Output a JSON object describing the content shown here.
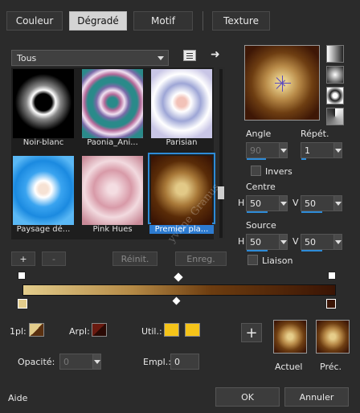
{
  "tabs": [
    {
      "label": "Couleur"
    },
    {
      "label": "Dégradé",
      "active": true
    },
    {
      "label": "Motif"
    },
    {
      "label": "Texture"
    }
  ],
  "category": {
    "value": "Tous"
  },
  "gallery": [
    {
      "name": "Noir-blanc"
    },
    {
      "name": "Paonia_Ani..."
    },
    {
      "name": "Parisian"
    },
    {
      "name": "Paysage dé..."
    },
    {
      "name": "Pink Hues"
    },
    {
      "name": "Premier pla...",
      "selected": true
    }
  ],
  "gallery_buttons": {
    "add": "+",
    "remove": "-",
    "reset": "Réinit.",
    "save": "Enreg."
  },
  "angle": {
    "label": "Angle",
    "value": "90"
  },
  "repeat": {
    "label": "Répét.",
    "value": "1"
  },
  "invert": {
    "label": "Invers"
  },
  "center": {
    "label": "Centre",
    "h_label": "H",
    "h_value": "50",
    "v_label": "V",
    "v_value": "50"
  },
  "source": {
    "label": "Source",
    "h_label": "H",
    "h_value": "50",
    "v_label": "V",
    "v_value": "50"
  },
  "link": {
    "label": "Liaison"
  },
  "watermark": "yvline Granus",
  "bottom": {
    "fg_label": "1pl:",
    "bg_label": "Arpl:",
    "user_label": "Util.:",
    "opacity_label": "Opacité:",
    "opacity_value": "0",
    "location_label": "Empl.:",
    "location_value": "0",
    "add_button": "+",
    "current_label": "Actuel",
    "previous_label": "Préc."
  },
  "footer": {
    "help": "Aide",
    "ok": "OK",
    "cancel": "Annuler"
  },
  "colors": {
    "accent": "#2d8bd8",
    "user_swatch": "#f5c419"
  }
}
